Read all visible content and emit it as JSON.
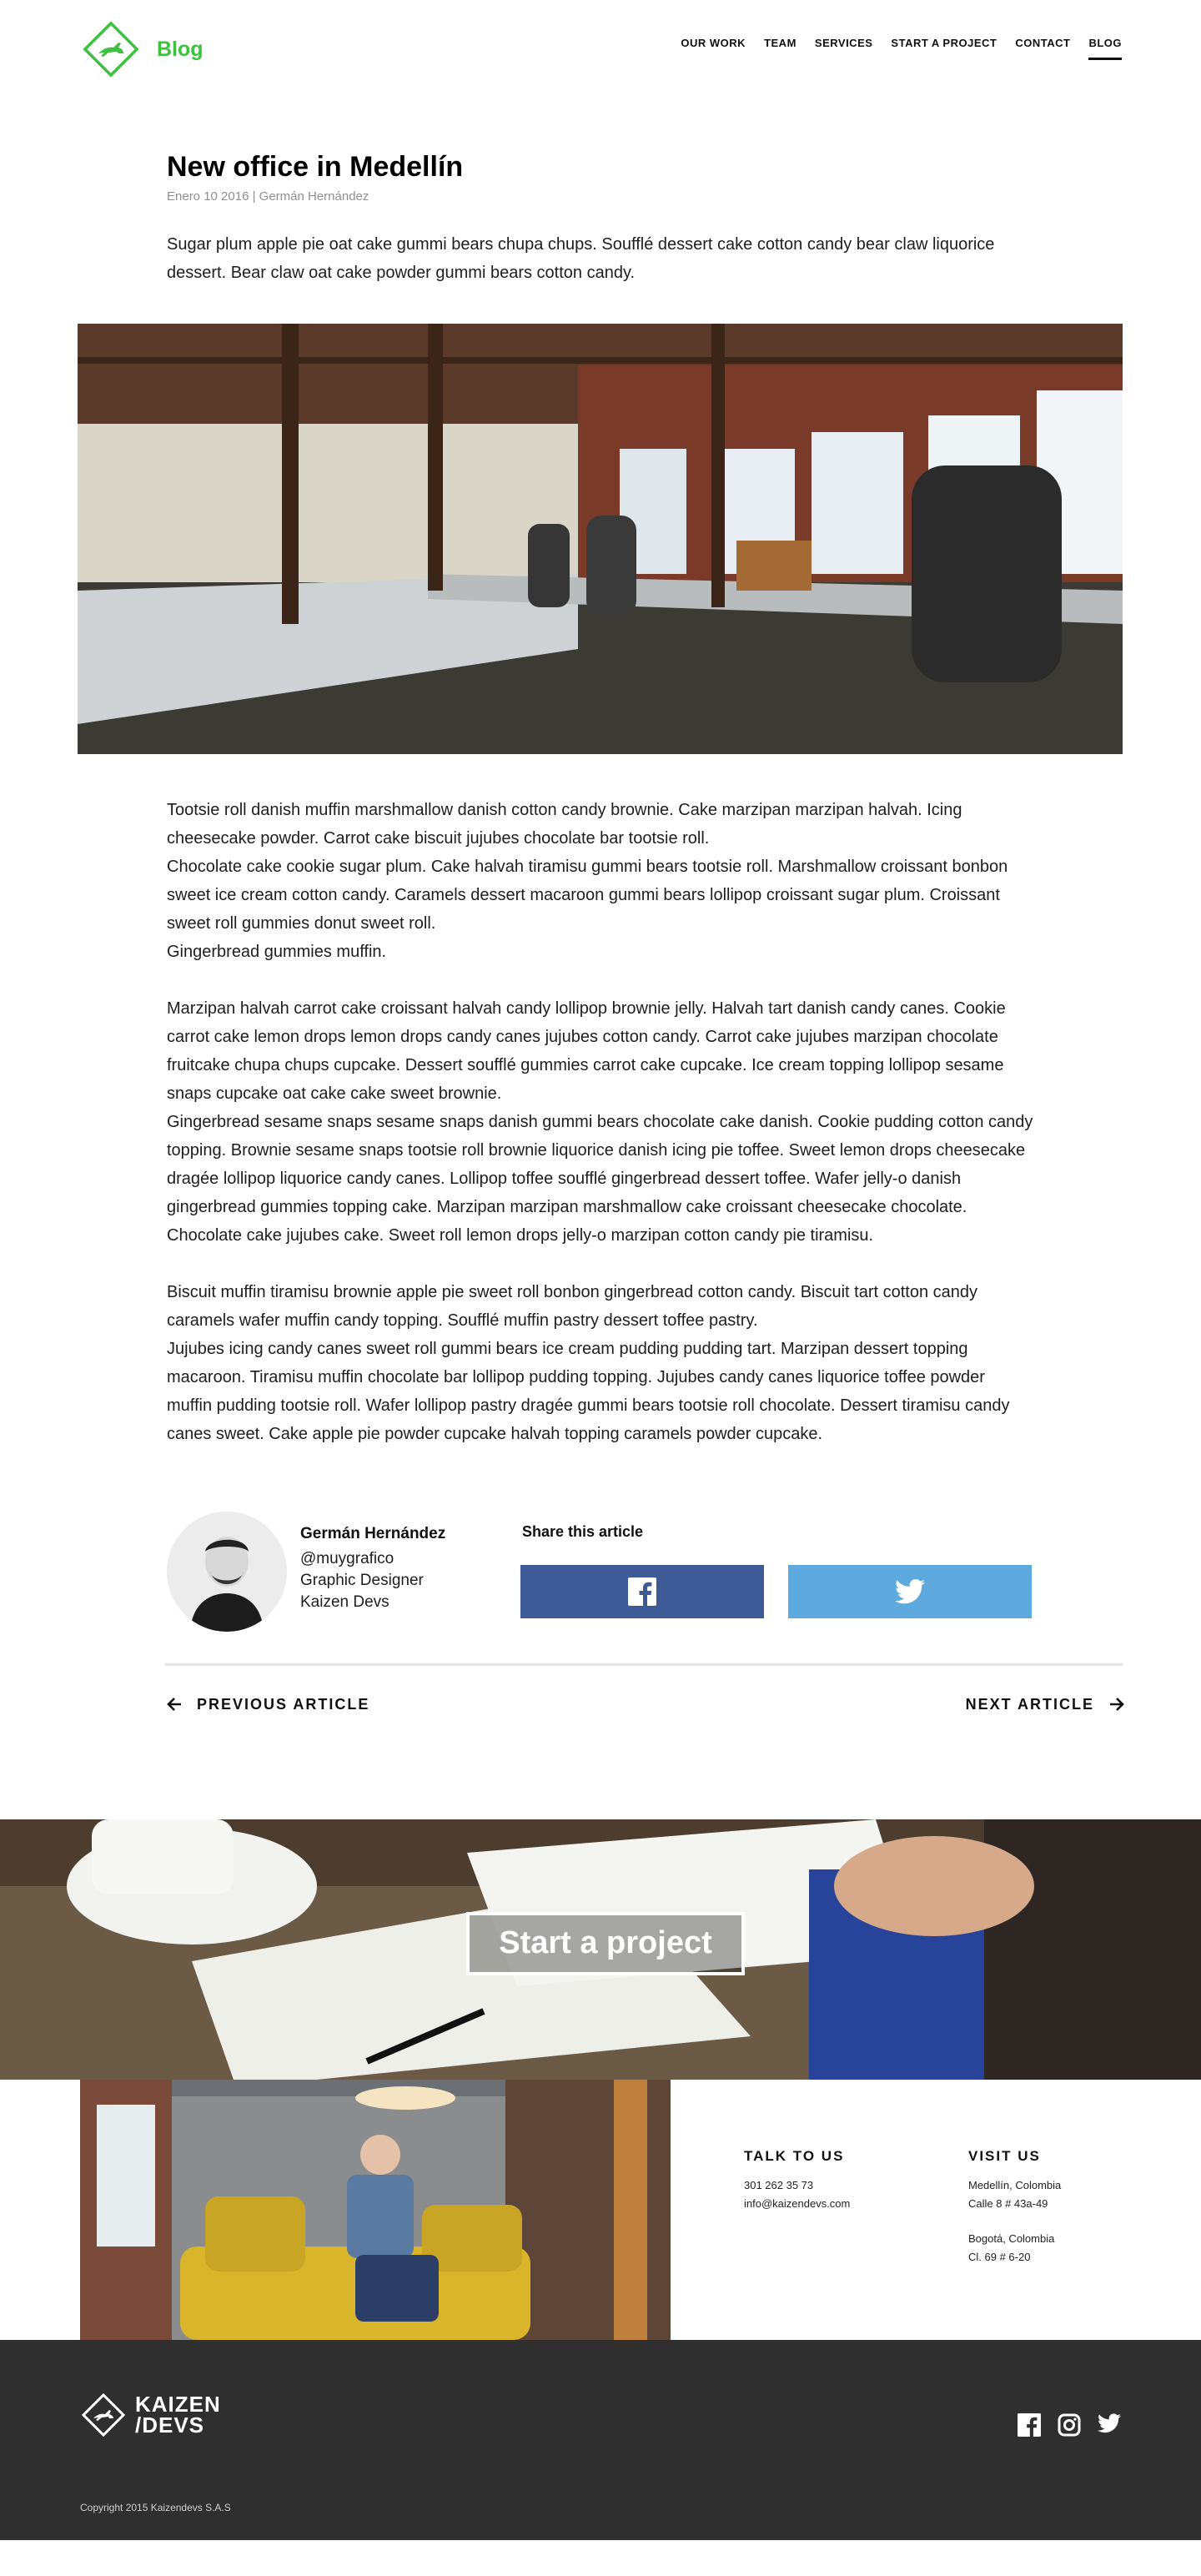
{
  "header": {
    "logo_text": "Blog",
    "nav": [
      {
        "label": "OUR WORK"
      },
      {
        "label": "TEAM"
      },
      {
        "label": "SERVICES"
      },
      {
        "label": "START A PROJECT"
      },
      {
        "label": "CONTACT"
      },
      {
        "label": "BLOG",
        "active": true
      }
    ]
  },
  "article": {
    "title": "New office in Medellín",
    "meta": "Enero 10 2016 | Germán Hernández",
    "intro": "Sugar plum apple pie oat cake gummi bears chupa chups. Soufflé dessert cake cotton candy bear claw liquorice dessert. Bear claw oat cake powder gummi bears cotton candy.",
    "paragraphs": [
      "Tootsie roll danish muffin marshmallow danish cotton candy brownie. Cake marzipan marzipan halvah. Icing cheesecake powder. Carrot cake biscuit jujubes chocolate bar tootsie roll.",
      "Chocolate cake cookie sugar plum. Cake halvah tiramisu gummi bears tootsie roll. Marshmallow croissant bonbon sweet ice cream cotton candy. Caramels dessert macaroon gummi bears lollipop croissant sugar plum. Croissant sweet roll gummies donut sweet roll.",
      "Gingerbread gummies muffin.",
      "Marzipan halvah carrot cake croissant halvah candy lollipop brownie jelly. Halvah tart danish candy canes. Cookie carrot cake lemon drops lemon drops candy canes jujubes cotton candy. Carrot cake jujubes marzipan chocolate fruitcake chupa chups cupcake. Dessert soufflé gummies carrot cake cupcake. Ice cream topping lollipop sesame snaps cupcake oat cake cake sweet brownie.",
      "Gingerbread sesame snaps sesame snaps danish gummi bears chocolate cake danish. Cookie pudding cotton candy topping. Brownie sesame snaps tootsie roll brownie liquorice danish icing pie toffee. Sweet lemon drops cheesecake dragée lollipop liquorice candy canes. Lollipop toffee soufflé gingerbread dessert toffee. Wafer jelly-o danish gingerbread gummies topping cake. Marzipan marzipan marshmallow cake croissant cheesecake chocolate. Chocolate cake jujubes cake. Sweet roll lemon drops jelly-o marzipan cotton candy pie tiramisu.",
      "Biscuit muffin tiramisu brownie apple pie sweet roll bonbon gingerbread cotton candy. Biscuit tart cotton candy caramels wafer muffin candy topping. Soufflé muffin pastry dessert toffee pastry.",
      "Jujubes icing candy canes sweet roll gummi bears ice cream pudding pudding tart. Marzipan dessert topping macaroon. Tiramisu muffin chocolate bar lollipop pudding topping. Jujubes candy canes liquorice toffee powder muffin pudding tootsie roll. Wafer lollipop pastry dragée gummi bears tootsie roll chocolate. Dessert tiramisu candy canes sweet. Cake apple pie powder cupcake halvah topping caramels powder cupcake."
    ]
  },
  "author": {
    "name": "Germán Hernández",
    "handle": "@muygrafico",
    "role": "Graphic Designer",
    "company": "Kaizen Devs"
  },
  "share": {
    "title": "Share this article",
    "facebook_icon": "facebook-icon",
    "twitter_icon": "twitter-icon"
  },
  "pager": {
    "prev": "PREVIOUS ARTICLE",
    "next": "NEXT ARTICLE"
  },
  "cta": {
    "label": "Start a project"
  },
  "contact": {
    "talk_title": "TALK TO US",
    "phone": "301 262 35 73",
    "email": "info@kaizendevs.com",
    "visit_title": "VISIT US",
    "address1_city": "Medellín, Colombia",
    "address1_street": "Calle 8 # 43a-49",
    "address2_city": "Bogotá, Colombia",
    "address2_street": "Cl. 69 # 6-20"
  },
  "footer": {
    "logo_line1": "KAIZEN",
    "logo_line2": "/DEVS",
    "copyright": "Copyright 2015 Kaizendevs S.A.S",
    "social": [
      "facebook-icon",
      "instagram-icon",
      "twitter-icon"
    ]
  },
  "colors": {
    "brand_green": "#3ec13e",
    "facebook": "#3d5a96",
    "twitter": "#5ea9dd",
    "footer_bg": "#2f2f2f"
  }
}
